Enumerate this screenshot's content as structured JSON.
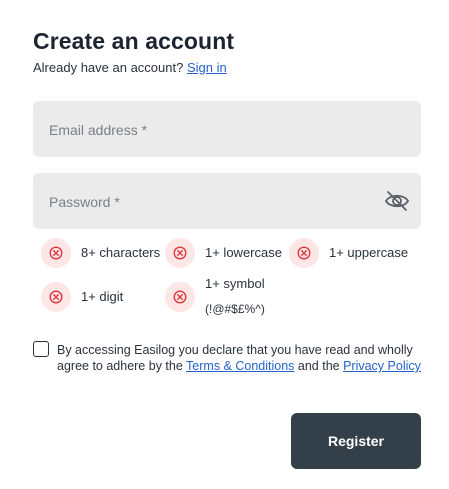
{
  "header": {
    "title": "Create an account",
    "subtitle": "Already have an account?",
    "signin_link": "Sign in"
  },
  "form": {
    "email_placeholder": "Email address  *",
    "password_placeholder": "Password  *",
    "password_toggle_icon": "eye-slash-icon"
  },
  "password_rules": [
    {
      "text": "8+ characters",
      "status": "unmet",
      "icon": "x-circle-icon"
    },
    {
      "text": "1+ lowercase",
      "status": "unmet",
      "icon": "x-circle-icon"
    },
    {
      "text": "1+ uppercase",
      "status": "unmet",
      "icon": "x-circle-icon"
    },
    {
      "text": "1+ digit",
      "status": "unmet",
      "icon": "x-circle-icon"
    },
    {
      "text": "1+ symbol",
      "text_line2": "(!@#$£%^)",
      "status": "unmet",
      "icon": "x-circle-icon"
    }
  ],
  "consent": {
    "checked": false,
    "text_before": "By accessing Easilog you declare that you have read and wholly agree to adhere by the ",
    "terms_link": "Terms & Conditions",
    "text_middle": " and the ",
    "privacy_link": "Privacy Policy"
  },
  "register_button": "Register",
  "colors": {
    "accent_link": "#2563c9",
    "button_bg": "#344049",
    "field_bg": "#ebebeb",
    "rule_badge_bg": "#fde6e6",
    "rule_icon": "#e0383e"
  }
}
